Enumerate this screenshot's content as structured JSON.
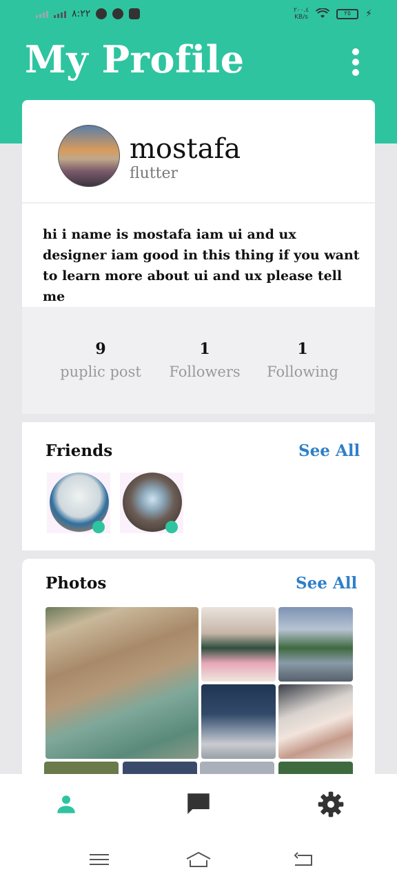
{
  "statusbar": {
    "time": "٨:٢٢",
    "speed_value": "٢٠٠.٤",
    "speed_unit": "KB/s",
    "battery": "٢٥"
  },
  "header": {
    "title": "My Profile"
  },
  "profile": {
    "name": "mostafa",
    "subtitle": "flutter",
    "bio": "hi i name is mostafa iam ui and ux designer iam good in this thing if you want to learn more about ui and ux please tell me"
  },
  "stats": [
    {
      "value": "9",
      "label": "puplic post"
    },
    {
      "value": "1",
      "label": "Followers"
    },
    {
      "value": "1",
      "label": "Following"
    }
  ],
  "friends": {
    "title": "Friends",
    "see_all": "See All",
    "count_shown": 2
  },
  "photos": {
    "title": "Photos",
    "see_all": "See All"
  },
  "colors": {
    "accent": "#2ec4a0",
    "link": "#2f7fc9",
    "background": "#e8e8ea"
  },
  "bottom_nav": [
    {
      "name": "profile",
      "icon": "person-icon",
      "active": true
    },
    {
      "name": "messages",
      "icon": "chat-icon",
      "active": false
    },
    {
      "name": "settings",
      "icon": "gear-icon",
      "active": false
    }
  ]
}
